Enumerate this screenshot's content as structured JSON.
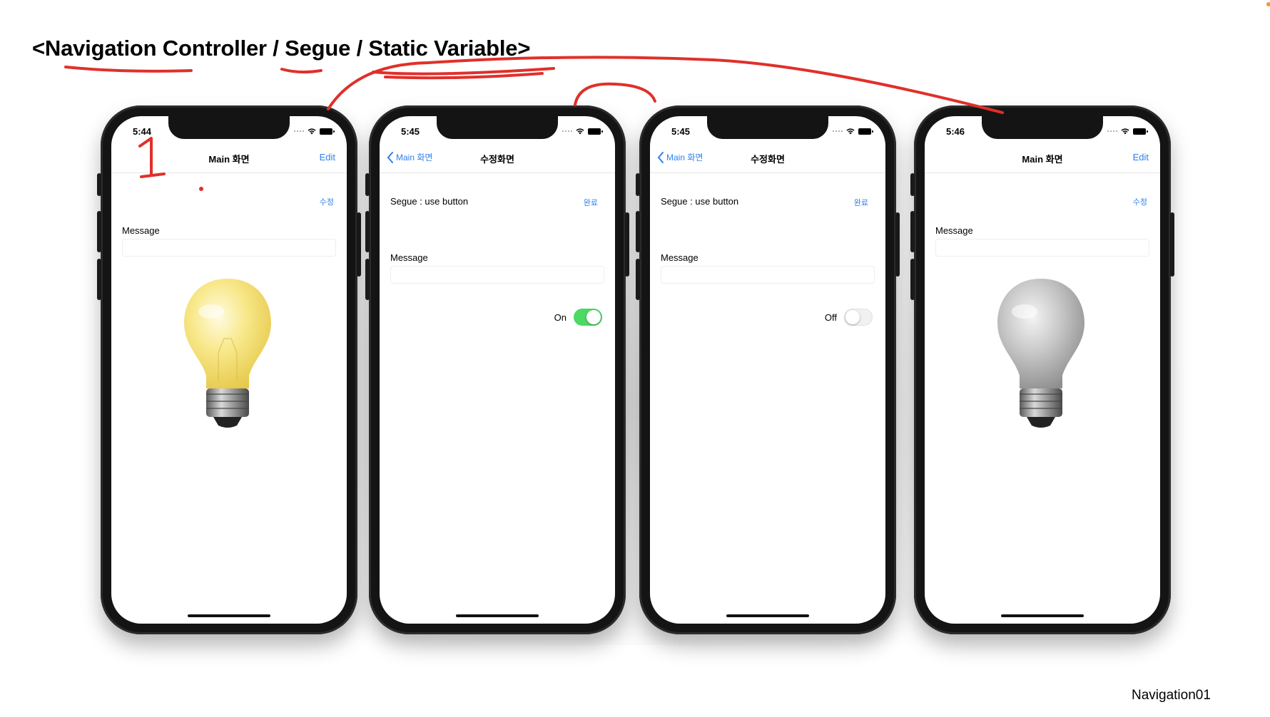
{
  "slide": {
    "title": "<Navigation Controller / Segue / Static Variable>",
    "footer": "Navigation01"
  },
  "annotation": {
    "handwritten_number": "1",
    "ink_color": "#e0302a"
  },
  "colors": {
    "accent": "#2f80ed",
    "toggle_on": "#4cd964",
    "bulb_on": "#f6e27a",
    "bulb_off": "#c8c8c8"
  },
  "phones": [
    {
      "time": "5:44",
      "nav": {
        "title": "Main 화면",
        "right": "Edit"
      },
      "edit_link": "수정",
      "message_label": "Message",
      "bulb": {
        "icon": "lightbulb-on-icon",
        "state": "on"
      }
    },
    {
      "time": "5:45",
      "nav": {
        "back": "Main 화면",
        "title": "수정화면"
      },
      "segue_label": "Segue : use button",
      "done_link": "완료",
      "message_label": "Message",
      "switch": {
        "label": "On",
        "state": "on"
      }
    },
    {
      "time": "5:45",
      "nav": {
        "back": "Main 화면",
        "title": "수정화면"
      },
      "segue_label": "Segue : use button",
      "done_link": "완료",
      "message_label": "Message",
      "switch": {
        "label": "Off",
        "state": "off"
      }
    },
    {
      "time": "5:46",
      "nav": {
        "title": "Main 화면",
        "right": "Edit"
      },
      "edit_link": "수정",
      "message_label": "Message",
      "bulb": {
        "icon": "lightbulb-off-icon",
        "state": "off"
      }
    }
  ]
}
